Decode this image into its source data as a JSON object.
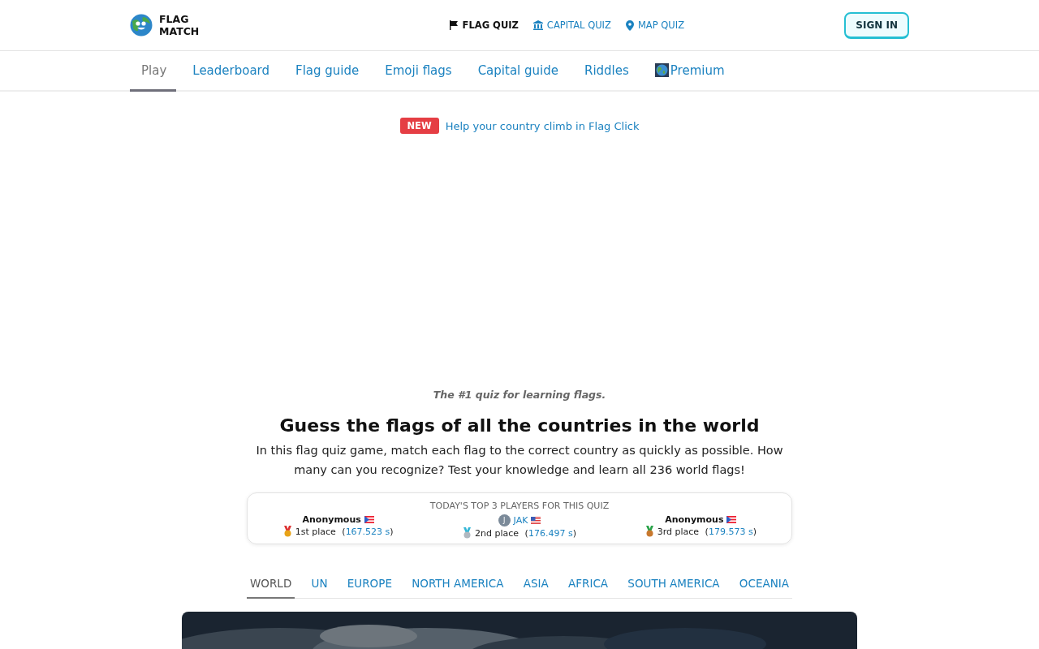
{
  "logo": {
    "line1": "FLAG",
    "line2": "MATCH"
  },
  "quiz_links": [
    {
      "label": "FLAG QUIZ",
      "selected": true
    },
    {
      "label": "CAPITAL QUIZ",
      "selected": false
    },
    {
      "label": "MAP QUIZ",
      "selected": false
    }
  ],
  "sign_in": "SIGN IN",
  "nav_tabs": [
    {
      "label": "Play",
      "selected": true
    },
    {
      "label": "Leaderboard",
      "selected": false
    },
    {
      "label": "Flag guide",
      "selected": false
    },
    {
      "label": "Emoji flags",
      "selected": false
    },
    {
      "label": "Capital guide",
      "selected": false
    },
    {
      "label": "Riddles",
      "selected": false
    },
    {
      "label": "Premium",
      "selected": false
    }
  ],
  "announcement": {
    "badge": "NEW",
    "link": "Help your country climb in Flag Click"
  },
  "tagline": "The #1 quiz for learning flags.",
  "heading": "Guess the flags of all the countries in the world",
  "intro": "In this flag quiz game, match each flag to the correct country as quickly as possible. How many can you recognize? Test your knowledge and learn all 236 world flags!",
  "top_players": {
    "title": "TODAY'S TOP 3 PLAYERS FOR THIS QUIZ",
    "players": [
      {
        "name": "Anonymous",
        "kind": "anonymous",
        "place": "1st place",
        "time": "(167.523 s)",
        "color": "#e8a317"
      },
      {
        "name": "JAK",
        "kind": "user",
        "avatar_letter": "J",
        "place": "2nd place",
        "time": "(176.497 s)",
        "color": "#b0b8c0"
      },
      {
        "name": "Anonymous",
        "kind": "anonymous",
        "place": "3rd place",
        "time": "(179.573 s)",
        "color": "#c8782e"
      }
    ]
  },
  "region_tabs": [
    {
      "label": "WORLD",
      "selected": true
    },
    {
      "label": "UN",
      "selected": false
    },
    {
      "label": "EUROPE",
      "selected": false
    },
    {
      "label": "NORTH AMERICA",
      "selected": false
    },
    {
      "label": "ASIA",
      "selected": false
    },
    {
      "label": "AFRICA",
      "selected": false
    },
    {
      "label": "SOUTH AMERICA",
      "selected": false
    },
    {
      "label": "OCEANIA",
      "selected": false
    }
  ]
}
